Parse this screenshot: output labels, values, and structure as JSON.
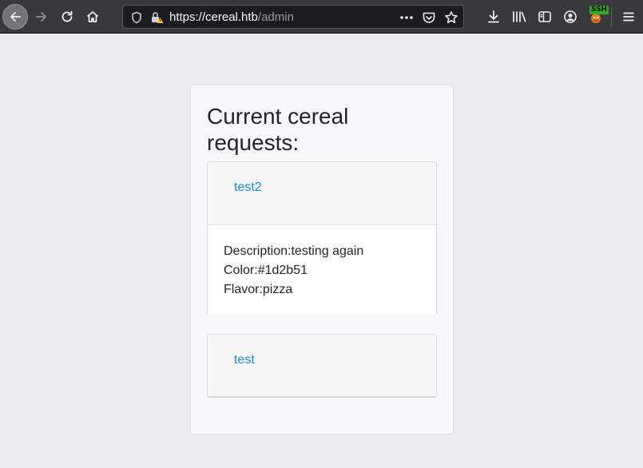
{
  "browser": {
    "url_host": "https://cereal.htb",
    "url_path": "/admin",
    "ssh_badge": "SSH",
    "icons": [
      "back-arrow-icon",
      "forward-arrow-icon",
      "reload-icon",
      "home-icon",
      "shield-icon",
      "insecure-lock-icon",
      "more-dots-icon",
      "pocket-icon",
      "bookmark-star-icon",
      "download-icon",
      "library-icon",
      "sidebar-icon",
      "account-icon",
      "extension-icon",
      "hamburger-menu-icon"
    ]
  },
  "page": {
    "title": "Current cereal requests:",
    "requests": [
      {
        "name": "test2",
        "description_label": "Description:",
        "description": "testing again",
        "color_label": "Color:",
        "color": "#1d2b51",
        "flavor_label": "Flavor:",
        "flavor": "pizza"
      },
      {
        "name": "test"
      }
    ]
  },
  "colors": {
    "link": "#1a86d8",
    "toolbar": "#38383d",
    "page_background": "#e9ebee"
  }
}
